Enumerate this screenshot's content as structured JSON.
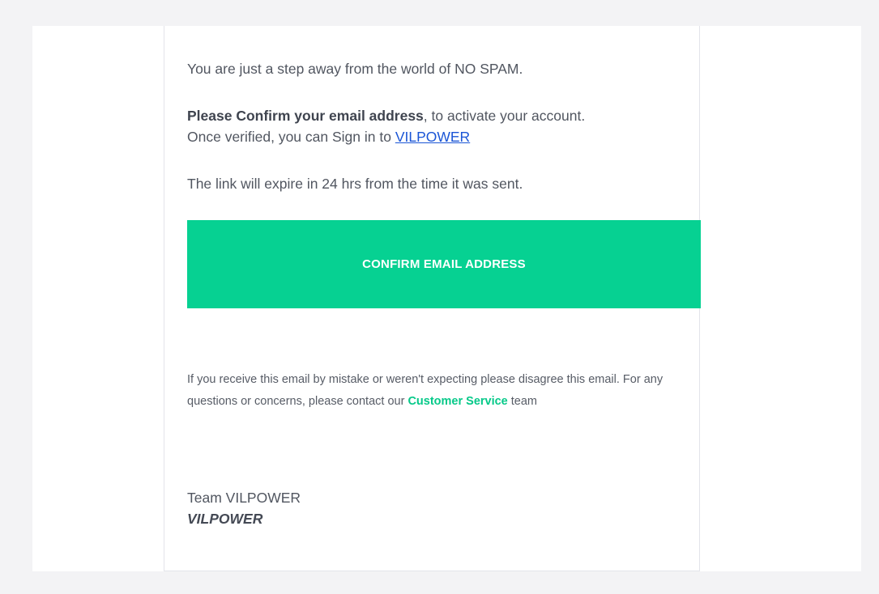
{
  "email": {
    "intro": "You are just a step away from the world of NO SPAM.",
    "confirm_bold": "Please Confirm your email address",
    "confirm_rest": ", to activate your account.",
    "signin_prefix": "Once verified, you can Sign in to ",
    "signin_link": "VILPOWER",
    "expiry": "The link will expire in 24 hrs from the time it was sent.",
    "button_label": "CONFIRM EMAIL ADDRESS",
    "notice_text": "If you receive this email by mistake or weren't expecting please disagree this email. For any questions or concerns, please contact our ",
    "notice_link": "Customer Service",
    "notice_suffix": " team",
    "signature_team": "Team VILPOWER",
    "signature_brand": "VILPOWER"
  },
  "colors": {
    "button_bg": "#06d192",
    "link": "#1a55d6",
    "accent_green": "#06c989",
    "background": "#f3f3f5"
  }
}
